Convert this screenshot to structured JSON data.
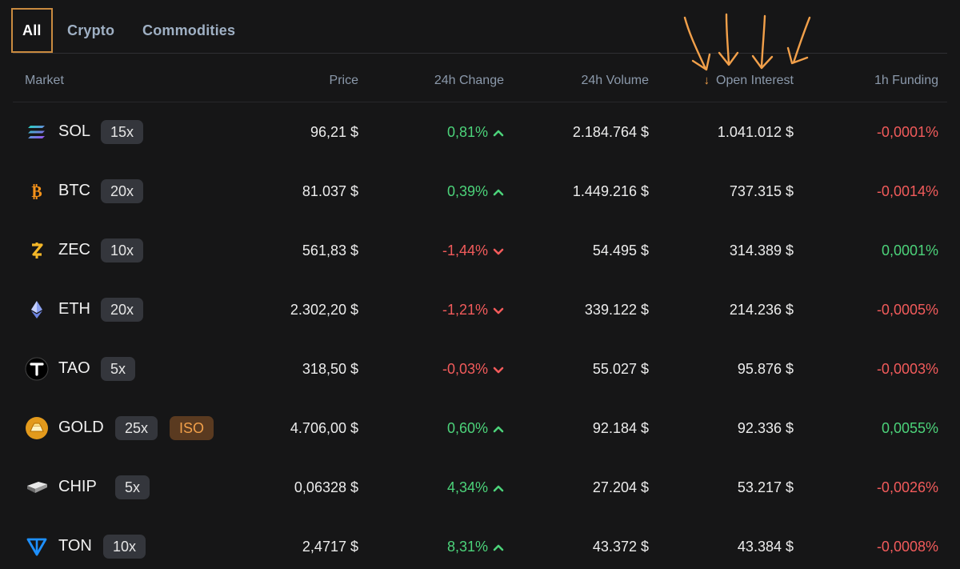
{
  "tabs": [
    {
      "label": "All",
      "active": true
    },
    {
      "label": "Crypto",
      "active": false
    },
    {
      "label": "Commodities",
      "active": false
    }
  ],
  "columns": {
    "market": "Market",
    "price": "Price",
    "change": "24h Change",
    "volume": "24h Volume",
    "open_interest": "Open Interest",
    "funding": "1h Funding"
  },
  "sort": {
    "column": "open_interest",
    "direction": "desc",
    "icon": "arrow-down-icon"
  },
  "colors": {
    "accent": "#f2a04a",
    "positive": "#4cd37a",
    "negative": "#f25b5b",
    "background": "#161617"
  },
  "rows": [
    {
      "ticker": "SOL",
      "leverage": "15x",
      "iso": "",
      "icon": "solana-icon",
      "price": "96,21 $",
      "change": "0,81%",
      "change_dir": "up",
      "volume": "2.184.764 $",
      "oi": "1.041.012 $",
      "funding": "-0,0001%",
      "funding_dir": "down"
    },
    {
      "ticker": "BTC",
      "leverage": "20x",
      "iso": "",
      "icon": "bitcoin-icon",
      "price": "81.037 $",
      "change": "0,39%",
      "change_dir": "up",
      "volume": "1.449.216 $",
      "oi": "737.315 $",
      "funding": "-0,0014%",
      "funding_dir": "down"
    },
    {
      "ticker": "ZEC",
      "leverage": "10x",
      "iso": "",
      "icon": "zcash-icon",
      "price": "561,83 $",
      "change": "-1,44%",
      "change_dir": "down",
      "volume": "54.495 $",
      "oi": "314.389 $",
      "funding": "0,0001%",
      "funding_dir": "up"
    },
    {
      "ticker": "ETH",
      "leverage": "20x",
      "iso": "",
      "icon": "ethereum-icon",
      "price": "2.302,20 $",
      "change": "-1,21%",
      "change_dir": "down",
      "volume": "339.122 $",
      "oi": "214.236 $",
      "funding": "-0,0005%",
      "funding_dir": "down"
    },
    {
      "ticker": "TAO",
      "leverage": "5x",
      "iso": "",
      "icon": "bittensor-icon",
      "price": "318,50 $",
      "change": "-0,03%",
      "change_dir": "down",
      "volume": "55.027 $",
      "oi": "95.876 $",
      "funding": "-0,0003%",
      "funding_dir": "down"
    },
    {
      "ticker": "GOLD",
      "leverage": "25x",
      "iso": "ISO",
      "icon": "gold-bar-icon",
      "price": "4.706,00 $",
      "change": "0,60%",
      "change_dir": "up",
      "volume": "92.184 $",
      "oi": "92.336 $",
      "funding": "0,0055%",
      "funding_dir": "up"
    },
    {
      "ticker": "CHIP",
      "leverage": "5x",
      "iso": "",
      "icon": "chip-icon",
      "price": "0,06328 $",
      "change": "4,34%",
      "change_dir": "up",
      "volume": "27.204 $",
      "oi": "53.217 $",
      "funding": "-0,0026%",
      "funding_dir": "down"
    },
    {
      "ticker": "TON",
      "leverage": "10x",
      "iso": "",
      "icon": "toncoin-icon",
      "price": "2,4717 $",
      "change": "8,31%",
      "change_dir": "up",
      "volume": "43.372 $",
      "oi": "43.384 $",
      "funding": "-0,0008%",
      "funding_dir": "down"
    }
  ]
}
